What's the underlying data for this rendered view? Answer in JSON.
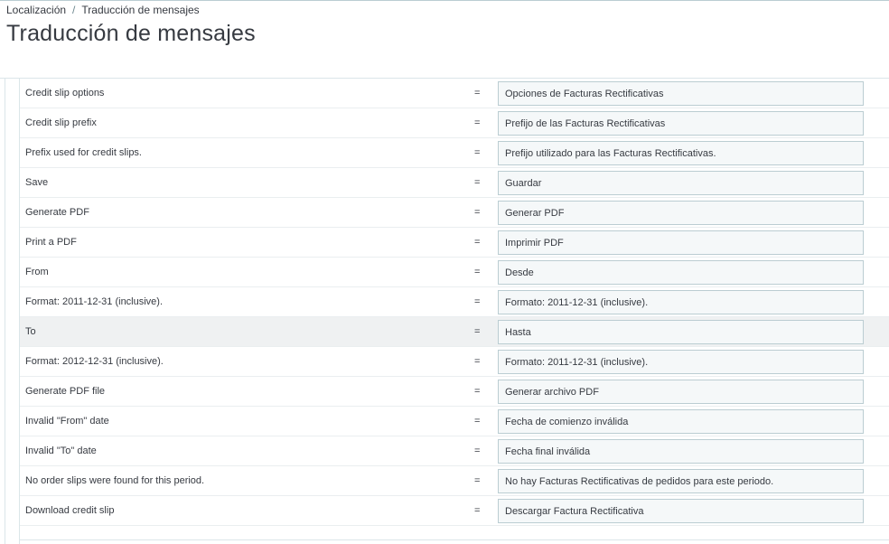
{
  "breadcrumb": {
    "parent": "Localización",
    "separator": "/",
    "current": "Traducción de mensajes"
  },
  "page_title": "Traducción de mensajes",
  "rows": [
    {
      "source": "Credit slip options",
      "eq": "=",
      "translation": "Opciones de Facturas Rectificativas"
    },
    {
      "source": "Credit slip prefix",
      "eq": "=",
      "translation": "Prefijo de las Facturas Rectificativas"
    },
    {
      "source": "Prefix used for credit slips.",
      "eq": "=",
      "translation": "Prefijo utilizado para las Facturas Rectificativas."
    },
    {
      "source": "Save",
      "eq": "=",
      "translation": "Guardar"
    },
    {
      "source": "Generate PDF",
      "eq": "=",
      "translation": "Generar PDF"
    },
    {
      "source": "Print a PDF",
      "eq": "=",
      "translation": "Imprimir PDF"
    },
    {
      "source": "From",
      "eq": "=",
      "translation": "Desde"
    },
    {
      "source": "Format: 2011-12-31 (inclusive).",
      "eq": "=",
      "translation": "Formato: 2011-12-31 (inclusive)."
    },
    {
      "source": "To",
      "eq": "=",
      "translation": "Hasta"
    },
    {
      "source": "Format: 2012-12-31 (inclusive).",
      "eq": "=",
      "translation": "Formato: 2011-12-31 (inclusive)."
    },
    {
      "source": "Generate PDF file",
      "eq": "=",
      "translation": "Generar archivo PDF"
    },
    {
      "source": "Invalid \"From\" date",
      "eq": "=",
      "translation": "Fecha de comienzo inválida"
    },
    {
      "source": "Invalid \"To\" date",
      "eq": "=",
      "translation": "Fecha final inválida"
    },
    {
      "source": "No order slips were found for this period.",
      "eq": "=",
      "translation": "No hay Facturas Rectificativas de pedidos para este periodo."
    },
    {
      "source": "Download credit slip",
      "eq": "=",
      "translation": "Descargar Factura Rectificativa"
    }
  ],
  "highlighted_row_index": 8
}
